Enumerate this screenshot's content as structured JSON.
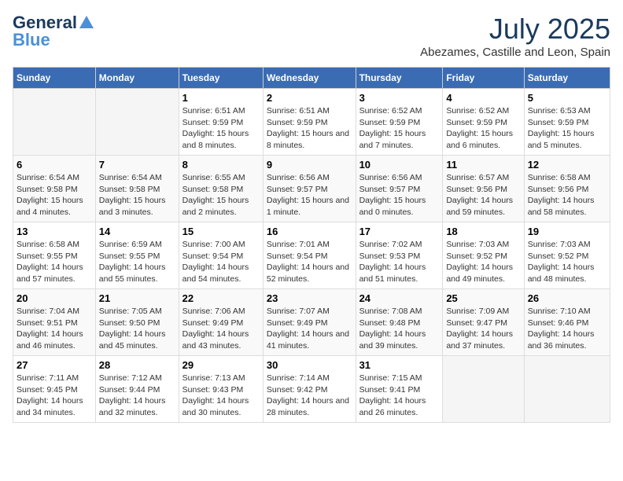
{
  "logo": {
    "general": "General",
    "blue": "Blue"
  },
  "title": {
    "month": "July 2025",
    "location": "Abezames, Castille and Leon, Spain"
  },
  "headers": [
    "Sunday",
    "Monday",
    "Tuesday",
    "Wednesday",
    "Thursday",
    "Friday",
    "Saturday"
  ],
  "weeks": [
    [
      {
        "day": "",
        "sunrise": "",
        "sunset": "",
        "daylight": ""
      },
      {
        "day": "",
        "sunrise": "",
        "sunset": "",
        "daylight": ""
      },
      {
        "day": "1",
        "sunrise": "Sunrise: 6:51 AM",
        "sunset": "Sunset: 9:59 PM",
        "daylight": "Daylight: 15 hours and 8 minutes."
      },
      {
        "day": "2",
        "sunrise": "Sunrise: 6:51 AM",
        "sunset": "Sunset: 9:59 PM",
        "daylight": "Daylight: 15 hours and 8 minutes."
      },
      {
        "day": "3",
        "sunrise": "Sunrise: 6:52 AM",
        "sunset": "Sunset: 9:59 PM",
        "daylight": "Daylight: 15 hours and 7 minutes."
      },
      {
        "day": "4",
        "sunrise": "Sunrise: 6:52 AM",
        "sunset": "Sunset: 9:59 PM",
        "daylight": "Daylight: 15 hours and 6 minutes."
      },
      {
        "day": "5",
        "sunrise": "Sunrise: 6:53 AM",
        "sunset": "Sunset: 9:59 PM",
        "daylight": "Daylight: 15 hours and 5 minutes."
      }
    ],
    [
      {
        "day": "6",
        "sunrise": "Sunrise: 6:54 AM",
        "sunset": "Sunset: 9:58 PM",
        "daylight": "Daylight: 15 hours and 4 minutes."
      },
      {
        "day": "7",
        "sunrise": "Sunrise: 6:54 AM",
        "sunset": "Sunset: 9:58 PM",
        "daylight": "Daylight: 15 hours and 3 minutes."
      },
      {
        "day": "8",
        "sunrise": "Sunrise: 6:55 AM",
        "sunset": "Sunset: 9:58 PM",
        "daylight": "Daylight: 15 hours and 2 minutes."
      },
      {
        "day": "9",
        "sunrise": "Sunrise: 6:56 AM",
        "sunset": "Sunset: 9:57 PM",
        "daylight": "Daylight: 15 hours and 1 minute."
      },
      {
        "day": "10",
        "sunrise": "Sunrise: 6:56 AM",
        "sunset": "Sunset: 9:57 PM",
        "daylight": "Daylight: 15 hours and 0 minutes."
      },
      {
        "day": "11",
        "sunrise": "Sunrise: 6:57 AM",
        "sunset": "Sunset: 9:56 PM",
        "daylight": "Daylight: 14 hours and 59 minutes."
      },
      {
        "day": "12",
        "sunrise": "Sunrise: 6:58 AM",
        "sunset": "Sunset: 9:56 PM",
        "daylight": "Daylight: 14 hours and 58 minutes."
      }
    ],
    [
      {
        "day": "13",
        "sunrise": "Sunrise: 6:58 AM",
        "sunset": "Sunset: 9:55 PM",
        "daylight": "Daylight: 14 hours and 57 minutes."
      },
      {
        "day": "14",
        "sunrise": "Sunrise: 6:59 AM",
        "sunset": "Sunset: 9:55 PM",
        "daylight": "Daylight: 14 hours and 55 minutes."
      },
      {
        "day": "15",
        "sunrise": "Sunrise: 7:00 AM",
        "sunset": "Sunset: 9:54 PM",
        "daylight": "Daylight: 14 hours and 54 minutes."
      },
      {
        "day": "16",
        "sunrise": "Sunrise: 7:01 AM",
        "sunset": "Sunset: 9:54 PM",
        "daylight": "Daylight: 14 hours and 52 minutes."
      },
      {
        "day": "17",
        "sunrise": "Sunrise: 7:02 AM",
        "sunset": "Sunset: 9:53 PM",
        "daylight": "Daylight: 14 hours and 51 minutes."
      },
      {
        "day": "18",
        "sunrise": "Sunrise: 7:03 AM",
        "sunset": "Sunset: 9:52 PM",
        "daylight": "Daylight: 14 hours and 49 minutes."
      },
      {
        "day": "19",
        "sunrise": "Sunrise: 7:03 AM",
        "sunset": "Sunset: 9:52 PM",
        "daylight": "Daylight: 14 hours and 48 minutes."
      }
    ],
    [
      {
        "day": "20",
        "sunrise": "Sunrise: 7:04 AM",
        "sunset": "Sunset: 9:51 PM",
        "daylight": "Daylight: 14 hours and 46 minutes."
      },
      {
        "day": "21",
        "sunrise": "Sunrise: 7:05 AM",
        "sunset": "Sunset: 9:50 PM",
        "daylight": "Daylight: 14 hours and 45 minutes."
      },
      {
        "day": "22",
        "sunrise": "Sunrise: 7:06 AM",
        "sunset": "Sunset: 9:49 PM",
        "daylight": "Daylight: 14 hours and 43 minutes."
      },
      {
        "day": "23",
        "sunrise": "Sunrise: 7:07 AM",
        "sunset": "Sunset: 9:49 PM",
        "daylight": "Daylight: 14 hours and 41 minutes."
      },
      {
        "day": "24",
        "sunrise": "Sunrise: 7:08 AM",
        "sunset": "Sunset: 9:48 PM",
        "daylight": "Daylight: 14 hours and 39 minutes."
      },
      {
        "day": "25",
        "sunrise": "Sunrise: 7:09 AM",
        "sunset": "Sunset: 9:47 PM",
        "daylight": "Daylight: 14 hours and 37 minutes."
      },
      {
        "day": "26",
        "sunrise": "Sunrise: 7:10 AM",
        "sunset": "Sunset: 9:46 PM",
        "daylight": "Daylight: 14 hours and 36 minutes."
      }
    ],
    [
      {
        "day": "27",
        "sunrise": "Sunrise: 7:11 AM",
        "sunset": "Sunset: 9:45 PM",
        "daylight": "Daylight: 14 hours and 34 minutes."
      },
      {
        "day": "28",
        "sunrise": "Sunrise: 7:12 AM",
        "sunset": "Sunset: 9:44 PM",
        "daylight": "Daylight: 14 hours and 32 minutes."
      },
      {
        "day": "29",
        "sunrise": "Sunrise: 7:13 AM",
        "sunset": "Sunset: 9:43 PM",
        "daylight": "Daylight: 14 hours and 30 minutes."
      },
      {
        "day": "30",
        "sunrise": "Sunrise: 7:14 AM",
        "sunset": "Sunset: 9:42 PM",
        "daylight": "Daylight: 14 hours and 28 minutes."
      },
      {
        "day": "31",
        "sunrise": "Sunrise: 7:15 AM",
        "sunset": "Sunset: 9:41 PM",
        "daylight": "Daylight: 14 hours and 26 minutes."
      },
      {
        "day": "",
        "sunrise": "",
        "sunset": "",
        "daylight": ""
      },
      {
        "day": "",
        "sunrise": "",
        "sunset": "",
        "daylight": ""
      }
    ]
  ]
}
